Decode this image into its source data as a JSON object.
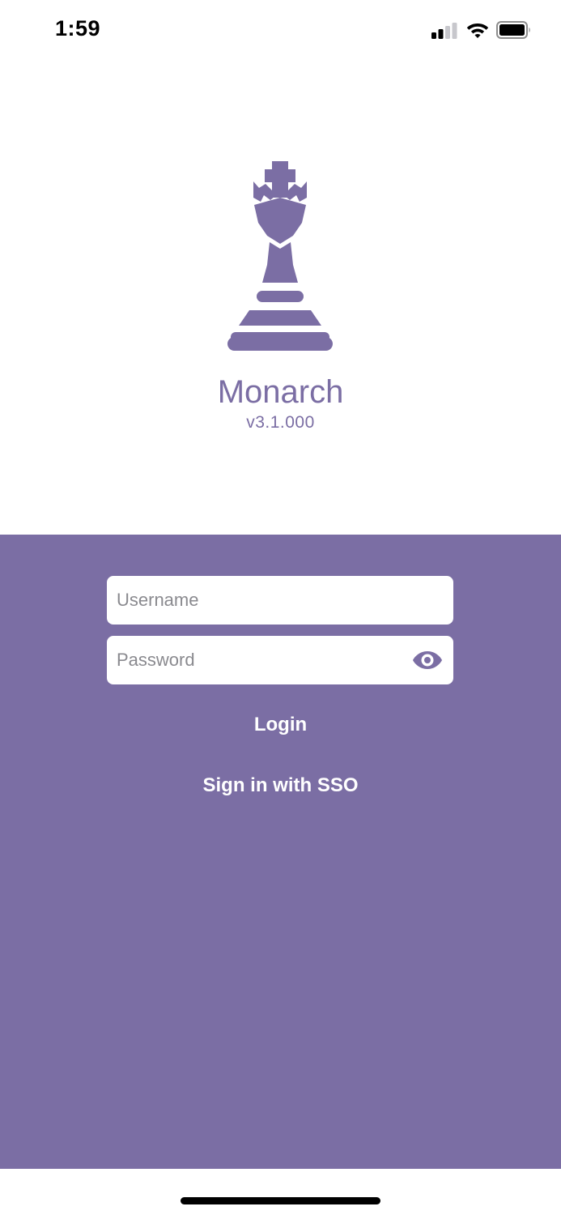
{
  "status_bar": {
    "time": "1:59",
    "icons": [
      "cellular-signal-icon",
      "wifi-icon",
      "battery-icon"
    ]
  },
  "app": {
    "name": "Monarch",
    "version": "v3.1.000",
    "logo_icon": "chess-king-icon",
    "brand_color": "#7b6ea4"
  },
  "login": {
    "username_placeholder": "Username",
    "username_value": "",
    "password_placeholder": "Password",
    "password_value": "",
    "show_password_icon": "eye-icon",
    "login_label": "Login",
    "sso_label": "Sign in with SSO"
  }
}
